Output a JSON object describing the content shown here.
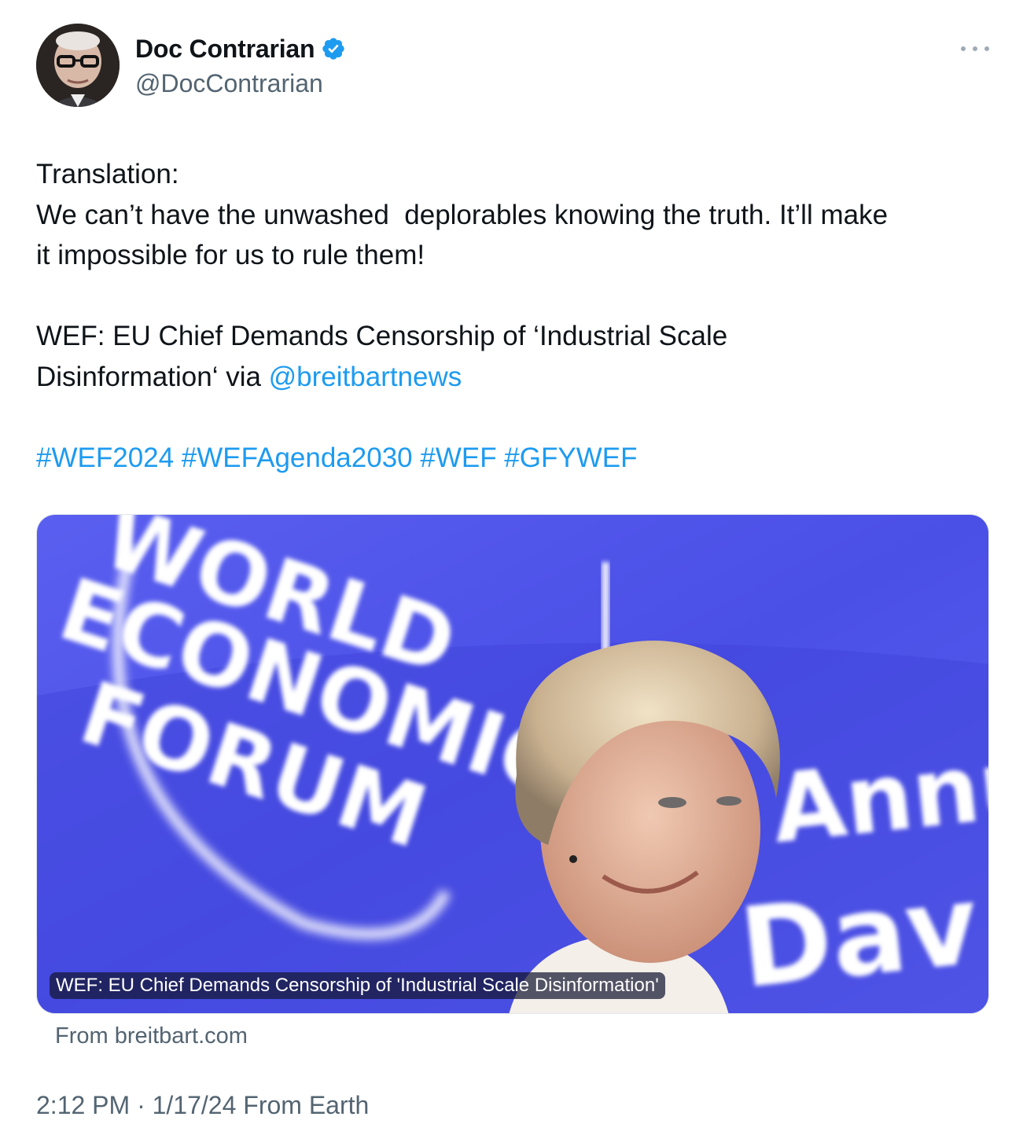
{
  "author": {
    "display_name": "Doc Contrarian",
    "handle": "@DocContrarian",
    "verified": true,
    "avatar_icon": "profile-photo-avatar"
  },
  "more_icon": "more-horizontal-icon",
  "text": {
    "line1": "Translation:",
    "line2": "We can’t have the unwashed  deplorables knowing the truth. It’ll make",
    "line3": "it impossible for us to rule them!",
    "line4": "WEF: EU Chief Demands Censorship of ‘Industrial Scale",
    "line5_prefix": "Disinformation‘ via ",
    "mention": "@breitbartnews",
    "hashtags": "#WEF2024 #WEFAgenda2030 #WEF #GFYWEF"
  },
  "card": {
    "caption": "WEF: EU Chief Demands Censorship of 'Industrial Scale Disinformation'",
    "source": "From breitbart.com",
    "backdrop_words": [
      "WORLD",
      "ECONOMIC",
      "FORUM",
      "Annu",
      "Dav"
    ]
  },
  "meta": {
    "timestamp": "2:12 PM · 1/17/24 From Earth"
  },
  "colors": {
    "link": "#1d9bf0",
    "secondary_text": "#536471",
    "card_background": "#4b52e6"
  }
}
